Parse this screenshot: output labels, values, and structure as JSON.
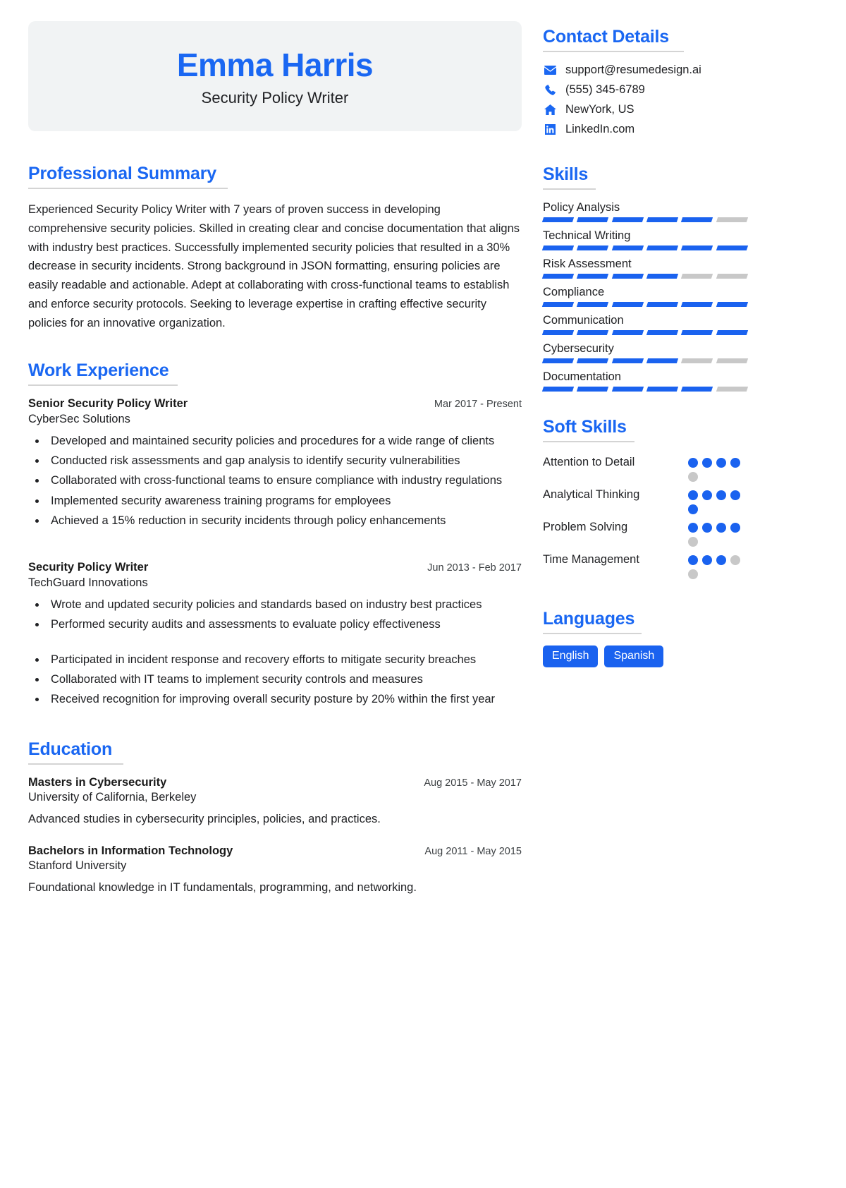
{
  "header": {
    "name": "Emma Harris",
    "job_title": "Security Policy Writer",
    "name_color": "#1a67f2",
    "banner_bg": "#f1f3f4"
  },
  "summary": {
    "heading": "Professional Summary",
    "text": "Experienced Security Policy Writer with 7 years of proven success in developing comprehensive security policies. Skilled in creating clear and concise documentation that aligns with industry best practices. Successfully implemented security policies that resulted in a 30% decrease in security incidents. Strong background in JSON formatting, ensuring policies are easily readable and actionable. Adept at collaborating with cross-functional teams to establish and enforce security protocols. Seeking to leverage expertise in crafting effective security policies for an innovative organization."
  },
  "work": {
    "heading": "Work Experience",
    "entries": [
      {
        "role": "Senior Security Policy Writer",
        "date": "Mar 2017 - Present",
        "org": "CyberSec Solutions",
        "bullets": [
          "Developed and maintained security policies and procedures for a wide range of clients",
          "Conducted risk assessments and gap analysis to identify security vulnerabilities",
          "Collaborated with cross-functional teams to ensure compliance with industry regulations",
          "Implemented security awareness training programs for employees",
          "Achieved a 15% reduction in security incidents through policy enhancements"
        ]
      },
      {
        "role": "Security Policy Writer",
        "date": "Jun 2013 - Feb 2017",
        "org": "TechGuard Innovations",
        "bullets": [
          "Wrote and updated security policies and standards based on industry best practices",
          "Performed security audits and assessments to evaluate policy effectiveness",
          "Participated in incident response and recovery efforts to mitigate security breaches",
          "Collaborated with IT teams to implement security controls and measures",
          "Received recognition for improving overall security posture by 20% within the first year"
        ]
      }
    ]
  },
  "education": {
    "heading": "Education",
    "entries": [
      {
        "degree": "Masters in Cybersecurity",
        "date": "Aug 2015 - May 2017",
        "school": "University of California, Berkeley",
        "description": "Advanced studies in cybersecurity principles, policies, and practices."
      },
      {
        "degree": "Bachelors in Information Technology",
        "date": "Aug 2011 - May 2015",
        "school": "Stanford University",
        "description": "Foundational knowledge in IT fundamentals, programming, and networking."
      }
    ]
  },
  "contact": {
    "heading": "Contact Details",
    "items": [
      {
        "icon": "envelope-icon",
        "value": "support@resumedesign.ai"
      },
      {
        "icon": "phone-icon",
        "value": "(555) 345-6789"
      },
      {
        "icon": "home-icon",
        "value": "NewYork, US"
      },
      {
        "icon": "linkedin-icon",
        "value": "LinkedIn.com"
      }
    ]
  },
  "skills": {
    "heading": "Skills",
    "segments_total": 6,
    "accent": "#1a62ef",
    "track": "#c8c8c8",
    "items": [
      {
        "label": "Policy Analysis",
        "filled": 5
      },
      {
        "label": "Technical Writing",
        "filled": 6
      },
      {
        "label": "Risk Assessment",
        "filled": 4
      },
      {
        "label": "Compliance",
        "filled": 6
      },
      {
        "label": "Communication",
        "filled": 6
      },
      {
        "label": "Cybersecurity",
        "filled": 4
      },
      {
        "label": "Documentation",
        "filled": 5
      }
    ]
  },
  "soft_skills": {
    "heading": "Soft Skills",
    "dots_total": 5,
    "items": [
      {
        "label": "Attention to Detail",
        "filled": 4
      },
      {
        "label": "Analytical Thinking",
        "filled": 5
      },
      {
        "label": "Problem Solving",
        "filled": 4
      },
      {
        "label": "Time Management",
        "filled": 3
      }
    ]
  },
  "languages": {
    "heading": "Languages",
    "items": [
      "English",
      "Spanish"
    ]
  }
}
